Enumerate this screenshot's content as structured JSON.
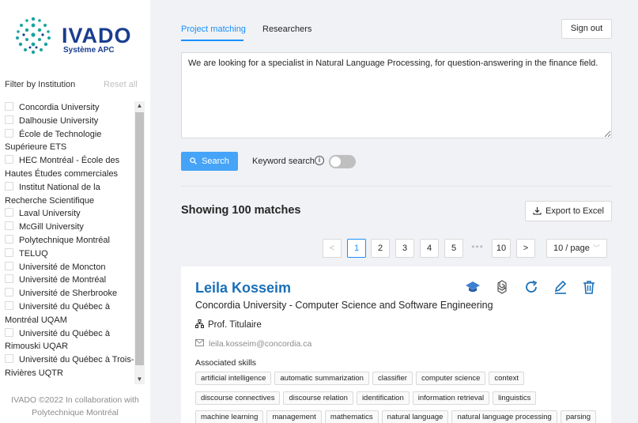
{
  "sidebar": {
    "logo": {
      "name": "IVADO",
      "subtitle": "Système APC"
    },
    "filter_title": "Filter by Institution",
    "reset_label": "Reset all",
    "institutions": [
      [
        "Concordia University"
      ],
      [
        "Dalhousie University"
      ],
      [
        "École de Technologie",
        "Supérieure ETS"
      ],
      [
        "HEC Montréal - École des",
        "Hautes Études commerciales"
      ],
      [
        "Institut National de la",
        "Recherche Scientifique"
      ],
      [
        "Laval University"
      ],
      [
        "McGill University"
      ],
      [
        "Polytechnique Montréal"
      ],
      [
        "TELUQ"
      ],
      [
        "Université de Moncton"
      ],
      [
        "Université de Montréal"
      ],
      [
        "Université de Sherbrooke"
      ],
      [
        "Université du Québec à",
        "Montréal UQAM"
      ],
      [
        "Université du Québec à",
        "Rimouski UQAR"
      ],
      [
        "Université du Québec à Trois-",
        "Rivières UQTR"
      ]
    ],
    "footer": [
      "IVADO ©2022 In collaboration with",
      "Polytechnique Montréal"
    ]
  },
  "tabs": [
    {
      "label": "Project matching",
      "active": true
    },
    {
      "label": "Researchers",
      "active": false
    }
  ],
  "sign_out_label": "Sign out",
  "query": {
    "value": "We are looking for a specialist in Natural Language Processing, for question-answering in the finance field."
  },
  "search_label": "Search",
  "keyword_search": {
    "label": "Keyword search",
    "enabled": false
  },
  "results": {
    "title": "Showing 100 matches",
    "export_label": "Export to Excel"
  },
  "pagination": {
    "prev": "<",
    "next": ">",
    "pages": [
      "1",
      "2",
      "3",
      "4",
      "5"
    ],
    "ellipsis": "•••",
    "last": "10",
    "current": "1",
    "page_size": "10 / page"
  },
  "card": {
    "name": "Leila Kosseim",
    "affiliation": "Concordia University - Computer Science and Software Engineering",
    "title": "Prof. Titulaire",
    "email": "leila.kosseim@concordia.ca",
    "skills_label": "Associated skills",
    "skills": [
      [
        "artificial intelligence",
        "automatic summarization",
        "classifier",
        "computer science",
        "context"
      ],
      [
        "discourse connectives",
        "discourse relation",
        "identification",
        "information retrieval",
        "linguistics"
      ],
      [
        "machine learning",
        "management",
        "mathematics",
        "natural language",
        "natural language processing",
        "parsing"
      ]
    ]
  },
  "colors": {
    "accent": "#1890ff",
    "name": "#1a6fb8",
    "brand": "#1a3d8f",
    "search_button": "#45a4f7"
  }
}
